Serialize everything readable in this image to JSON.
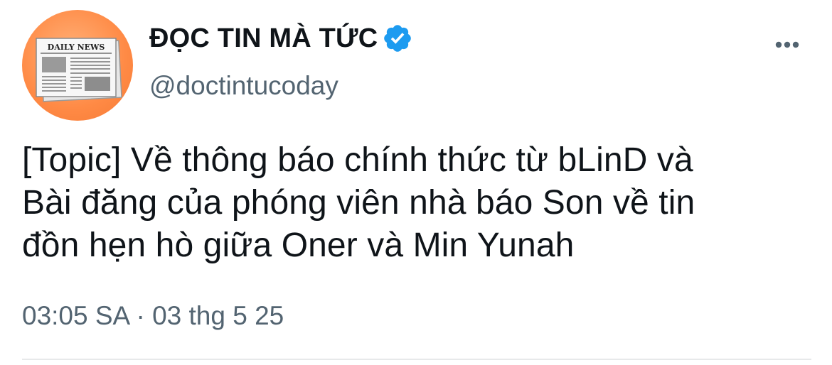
{
  "tweet": {
    "author": {
      "display_name": "ĐỌC TIN MÀ TỨC",
      "handle": "@doctintucoday",
      "verified": true,
      "avatar_icon": "newspaper-icon",
      "avatar_text": "DAILY NEWS",
      "avatar_color": "#ff8a45"
    },
    "text_lines": [
      "[Topic] Về thông báo chính thức từ bLinD và",
      "Bài đăng của phóng viên nhà báo Son về tin",
      "đồn hẹn hò giữa Oner và Min Yunah"
    ],
    "time": "03:05 SA",
    "separator": "·",
    "date": "03 thg 5 25",
    "more_icon": "more-icon",
    "verified_color": "#1d9bf0"
  }
}
